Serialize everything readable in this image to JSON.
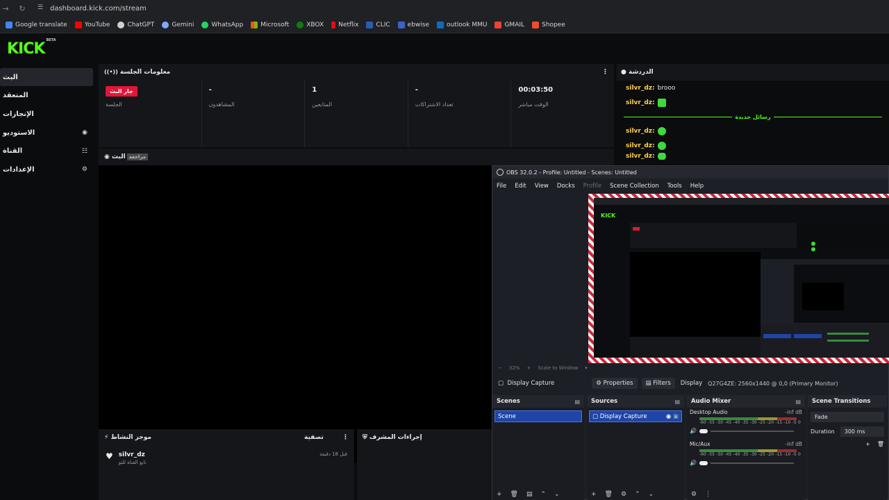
{
  "browser": {
    "url": "dashboard.kick.com/stream",
    "bookmarks": [
      "Google translate",
      "YouTube",
      "ChatGPT",
      "Gemini",
      "WhatsApp",
      "Microsoft",
      "XBOX",
      "Netflix",
      "CLIC",
      "ebwise",
      "outlook MMU",
      "GMAIL",
      "Shopee"
    ]
  },
  "logo": {
    "text": "KICK",
    "beta": "BETA"
  },
  "sidebar": {
    "items": [
      {
        "label": "البث",
        "icon": ""
      },
      {
        "label": "المتعقد",
        "icon": ""
      },
      {
        "label": "الإنجازات",
        "icon": ""
      },
      {
        "label": "الاستوديو",
        "icon": "studio-icon"
      },
      {
        "label": "القناة",
        "icon": "channel-icon"
      },
      {
        "label": "الإعدادات",
        "icon": "gear-icon"
      }
    ]
  },
  "session": {
    "title": "معلومات الجلسة",
    "stats": [
      {
        "value": "جار البث",
        "label": "الجلسة",
        "badge": true
      },
      {
        "value": "-",
        "label": "المشاهدون"
      },
      {
        "value": "1",
        "label": "المتابعين"
      },
      {
        "value": "-",
        "label": "تعداد الاشتراكات"
      },
      {
        "value": "00:03:50",
        "label": "الوقت مباشر"
      }
    ]
  },
  "preview": {
    "title": "البث",
    "tag": "مراجعة"
  },
  "activity": {
    "title": "موجز النشاط",
    "filter": "تصفية",
    "items": [
      {
        "name": "silvr_dz",
        "sub": "تابع القناة للتو",
        "time": "قبل 18 دقيقة"
      }
    ]
  },
  "mod": {
    "title": "إجراءات المشرف"
  },
  "chat": {
    "title": "الدردشة",
    "messages": [
      {
        "user": "silvr_dz:",
        "text": "brooo"
      },
      {
        "user": "silvr_dz:",
        "text": ""
      }
    ],
    "divider": "رسائل جديدة",
    "messages2": [
      {
        "user": "silvr_dz:",
        "text": ""
      },
      {
        "user": "silvr_dz:",
        "text": ""
      },
      {
        "user": "silvr_dz:",
        "text": ""
      }
    ]
  },
  "obs": {
    "title": "OBS 32.0.2 - Profile: Untitled - Scenes: Untitled",
    "menu": [
      "File",
      "Edit",
      "View",
      "Docks",
      "Profile",
      "Scene Collection",
      "Tools",
      "Help"
    ],
    "zoom": "32%",
    "scale_mode": "Scale to Window",
    "source_name": "Display Capture",
    "properties_label": "Properties",
    "filters_label": "Filters",
    "display_label": "Display",
    "display_value": "Q27G4ZE: 2560x1440 @ 0,0 (Primary Monitor)",
    "scenes_title": "Scenes",
    "scene_item": "Scene",
    "sources_title": "Sources",
    "source_item": "Display Capture",
    "mixer_title": "Audio Mixer",
    "channels": [
      {
        "name": "Desktop Audio",
        "db": "-inf dB"
      },
      {
        "name": "Mic/Aux",
        "db": "-inf dB"
      }
    ],
    "scale_ticks": [
      "-60",
      "-55",
      "-50",
      "-45",
      "-40",
      "-35",
      "-30",
      "-25",
      "-20",
      "-15",
      "-10",
      "-5",
      "0"
    ],
    "transitions_title": "Scene Transitions",
    "transition": "Fade",
    "duration_label": "Duration",
    "duration_value": "300 ms"
  },
  "colors": {
    "kick_green": "#53fc18",
    "live_red": "#e2163a",
    "obs_selected": "#1f45a8"
  }
}
